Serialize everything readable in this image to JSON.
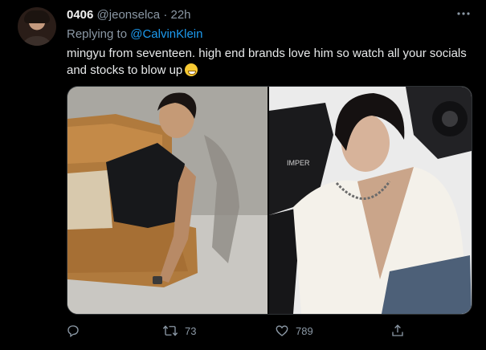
{
  "tweet": {
    "display_name": "0406",
    "handle": "@jeonselca",
    "separator": "·",
    "time": "22h",
    "reply_prefix": "Replying to",
    "reply_to": "@CalvinKlein",
    "text": "mingyu from seventeen. high end brands love him so watch all your socials and stocks to blow up",
    "emoji": "grinning-face-emoji",
    "brand_text_in_photo": "IMPER"
  },
  "actions": {
    "reply_count": "",
    "retweet_count": "73",
    "like_count": "789",
    "share_count": ""
  },
  "colors": {
    "background": "#000000",
    "primary_text": "#e7e9ea",
    "secondary_text": "#8b98a5",
    "link": "#1d9bf0",
    "border": "#2f3336"
  },
  "icons": {
    "more": "more-horizontal-icon",
    "reply": "reply-icon",
    "retweet": "retweet-icon",
    "like": "heart-icon",
    "share": "share-icon"
  }
}
